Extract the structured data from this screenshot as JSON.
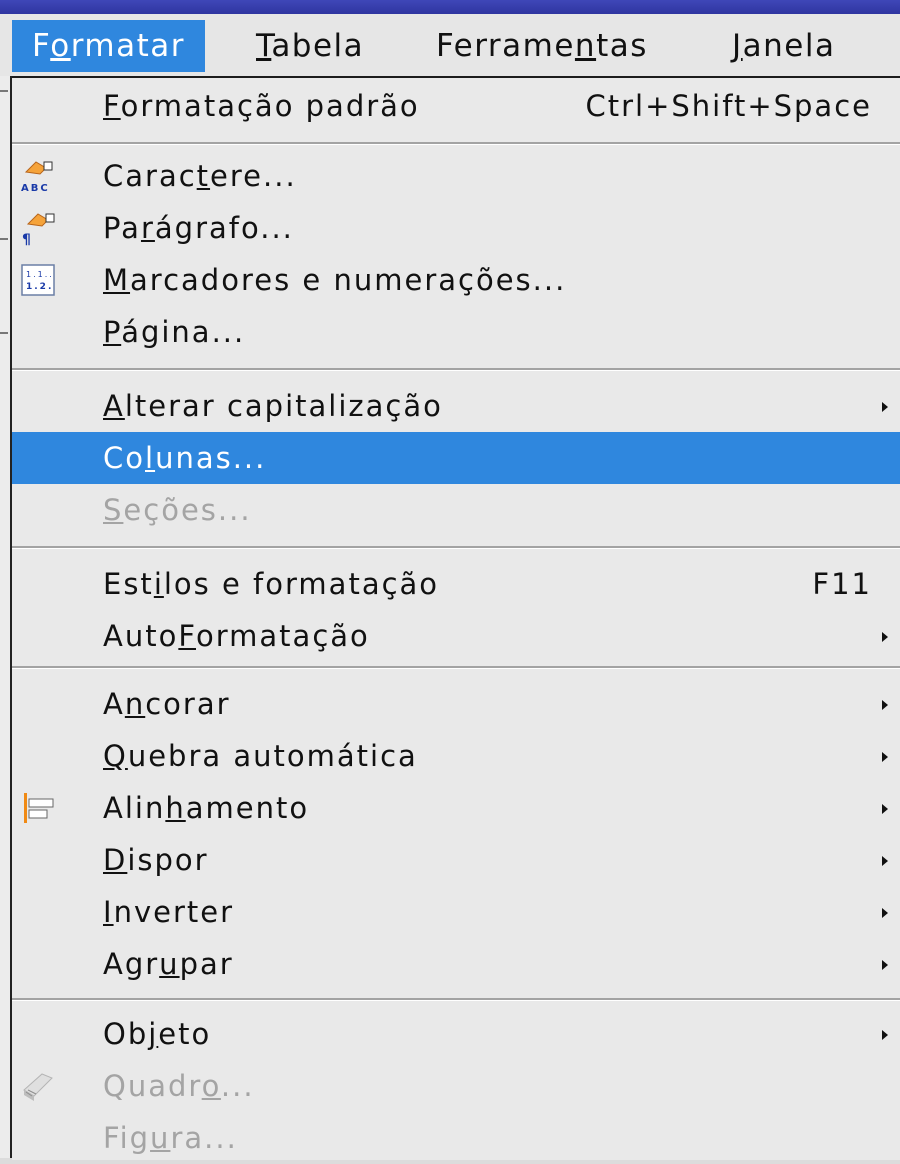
{
  "menubar": {
    "items": [
      {
        "pre": "F",
        "mn": "o",
        "post": "rmatar"
      },
      {
        "pre": "",
        "mn": "T",
        "post": "abela"
      },
      {
        "pre": "Ferrame",
        "mn": "n",
        "post": "tas"
      },
      {
        "pre": "",
        "mn": "J",
        "post": "anela"
      }
    ],
    "active_index": 0,
    "active_color": "#2f87de"
  },
  "menu": {
    "items": [
      {
        "pre": "",
        "mn": "F",
        "post": "ormatação padrão",
        "shortcut": "Ctrl+Shift+Space",
        "submenu": false,
        "enabled": true,
        "icon": ""
      },
      {
        "pre": "Carac",
        "mn": "t",
        "post": "ere...",
        "shortcut": "",
        "submenu": false,
        "enabled": true,
        "icon": "character-format-icon"
      },
      {
        "pre": "Pa",
        "mn": "r",
        "post": "ágrafo...",
        "shortcut": "",
        "submenu": false,
        "enabled": true,
        "icon": "paragraph-format-icon"
      },
      {
        "pre": "",
        "mn": "M",
        "post": "arcadores e numerações...",
        "shortcut": "",
        "submenu": false,
        "enabled": true,
        "icon": "bullets-numbering-icon"
      },
      {
        "pre": "",
        "mn": "P",
        "post": "ágina...",
        "shortcut": "",
        "submenu": false,
        "enabled": true,
        "icon": ""
      },
      {
        "pre": "",
        "mn": "A",
        "post": "lterar capitalização",
        "shortcut": "",
        "submenu": true,
        "enabled": true,
        "icon": ""
      },
      {
        "pre": "Co",
        "mn": "l",
        "post": "unas...",
        "shortcut": "",
        "submenu": false,
        "enabled": true,
        "icon": "",
        "highlighted": true
      },
      {
        "pre": "",
        "mn": "S",
        "post": "eções...",
        "shortcut": "",
        "submenu": false,
        "enabled": false,
        "icon": ""
      },
      {
        "pre": "Est",
        "mn": "i",
        "post": "los e formatação",
        "shortcut": "F11",
        "submenu": false,
        "enabled": true,
        "icon": ""
      },
      {
        "pre": "Auto",
        "mn": "F",
        "post": "ormatação",
        "shortcut": "",
        "submenu": true,
        "enabled": true,
        "icon": ""
      },
      {
        "pre": "A",
        "mn": "n",
        "post": "corar",
        "shortcut": "",
        "submenu": true,
        "enabled": true,
        "icon": ""
      },
      {
        "pre": "",
        "mn": "Q",
        "post": "uebra automática",
        "shortcut": "",
        "submenu": true,
        "enabled": true,
        "icon": ""
      },
      {
        "pre": "Alin",
        "mn": "h",
        "post": "amento",
        "shortcut": "",
        "submenu": true,
        "enabled": true,
        "icon": "alignment-icon"
      },
      {
        "pre": "",
        "mn": "D",
        "post": "ispor",
        "shortcut": "",
        "submenu": true,
        "enabled": true,
        "icon": ""
      },
      {
        "pre": "",
        "mn": "I",
        "post": "nverter",
        "shortcut": "",
        "submenu": true,
        "enabled": true,
        "icon": ""
      },
      {
        "pre": "Agr",
        "mn": "u",
        "post": "par",
        "shortcut": "",
        "submenu": true,
        "enabled": true,
        "icon": ""
      },
      {
        "pre": "Ob",
        "mn": "j",
        "post": "eto",
        "shortcut": "",
        "submenu": true,
        "enabled": true,
        "icon": ""
      },
      {
        "pre": "Quadr",
        "mn": "o",
        "post": "...",
        "shortcut": "",
        "submenu": false,
        "enabled": false,
        "icon": "frame-icon"
      },
      {
        "pre": "Fig",
        "mn": "u",
        "post": "ra...",
        "shortcut": "",
        "submenu": false,
        "enabled": false,
        "icon": ""
      }
    ],
    "highlight_color": "#2f87de",
    "disabled_color": "#a4a4a4"
  }
}
